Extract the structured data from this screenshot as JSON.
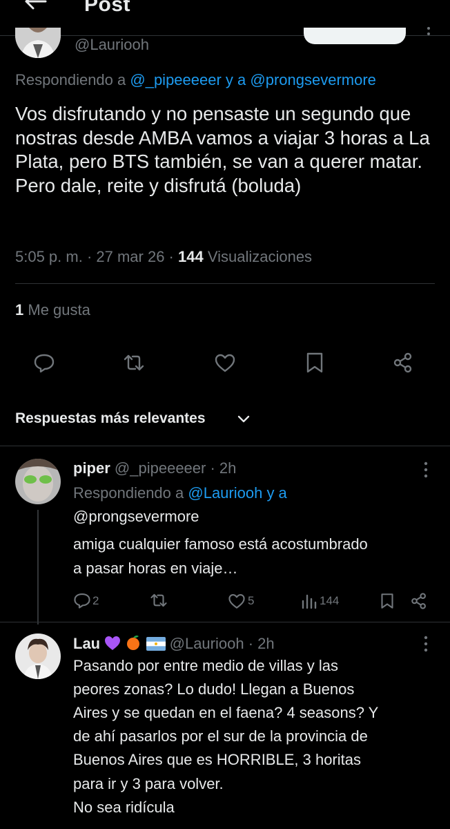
{
  "header": {
    "title": "Post"
  },
  "tweet": {
    "author_handle": "@Lauriooh",
    "replying_prefix": "Respondiendo a",
    "replying_to": "@_pipeeeeer y a @prongsevermore",
    "text": "Vos disfrutando y no pensaste un segundo que nostras desde AMBA vamos a viajar 3 horas a La Plata, pero BTS también, se van a querer matar. Pero dale, reite y disfrutá (boluda)",
    "time": "5:05 p. m. · 27 mar 26 · ",
    "views_count": "144",
    "views_label": " Visualizaciones",
    "likes_count": "1",
    "likes_label": " Me gusta"
  },
  "sort": {
    "label": "Respuestas más relevantes"
  },
  "replies": [
    {
      "name": "piper",
      "handle": "@_pipeeeeer",
      "time": "· 2h",
      "replying_prefix": "Respondiendo a",
      "replying_line1": "@Lauriooh y a",
      "replying_line2": "@prongsevermore",
      "line1": "amiga cualquier famoso está acostumbrado",
      "line2": "a pasar horas en viaje…",
      "replies": "2",
      "likes": "5",
      "views": "144"
    },
    {
      "name": "Lau",
      "handle": "@Lauriooh",
      "time": "· 2h",
      "lines": [
        "Pasando por entre medio de villas y las",
        "peores zonas? Lo dudo! Llegan a Buenos",
        "Aires y se quedan en el faena? 4 seasons? Y",
        "de ahí pasarlos por el sur de la provincia de",
        "Buenos Aires que es HORRIBLE, 3 horitas",
        "para ir y 3 para volver.",
        "No sea ridícula"
      ]
    }
  ],
  "colors": {
    "accent": "#1d9bf0",
    "muted": "#71767b",
    "text": "#e7e9ea",
    "background": "#000000"
  },
  "icons": [
    "back-arrow-icon",
    "more-icon",
    "reply-icon",
    "retweet-icon",
    "like-icon",
    "bookmark-icon",
    "share-icon",
    "chevron-down-icon",
    "views-icon",
    "heart-emoji",
    "tangerine-emoji",
    "argentina-flag-emoji"
  ]
}
